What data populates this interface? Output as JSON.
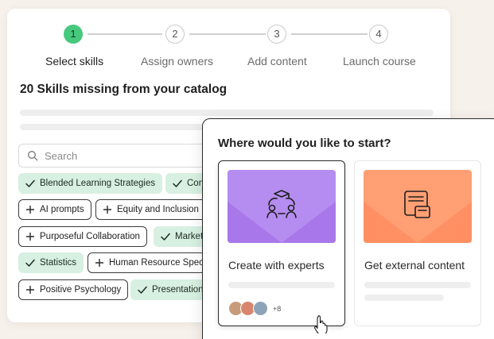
{
  "stepper": {
    "steps": [
      {
        "number": "1",
        "label": "Select skills",
        "state": "active"
      },
      {
        "number": "2",
        "label": "Assign owners",
        "state": "pending"
      },
      {
        "number": "3",
        "label": "Add content",
        "state": "pending"
      },
      {
        "number": "4",
        "label": "Launch course",
        "state": "pending"
      }
    ]
  },
  "catalog": {
    "heading": "20 Skills missing from your catalog",
    "search": {
      "placeholder": "Search",
      "icon": "search-icon"
    },
    "chips": [
      {
        "label": "Blended Learning Strategies",
        "state": "selected",
        "icon": "check-icon"
      },
      {
        "label": "Con",
        "state": "selected",
        "icon": "check-icon"
      },
      {
        "label": "AI prompts",
        "state": "unselected",
        "icon": "plus-icon"
      },
      {
        "label": "Equity and Inclusion",
        "state": "unselected",
        "icon": "plus-icon"
      },
      {
        "label": "Purposeful Collaboration",
        "state": "unselected",
        "icon": "plus-icon"
      },
      {
        "label": "Market",
        "state": "selected",
        "icon": "check-icon"
      },
      {
        "label": "Statistics",
        "state": "selected",
        "icon": "check-icon"
      },
      {
        "label": "Human Resource Speci",
        "state": "unselected",
        "icon": "plus-icon"
      },
      {
        "label": "Positive Psychology",
        "state": "unselected",
        "icon": "plus-icon"
      },
      {
        "label": "Presentation",
        "state": "selected",
        "icon": "check-icon"
      }
    ]
  },
  "modal": {
    "title": "Where would you like to start?",
    "options": [
      {
        "label": "Create with experts",
        "icon": "experts-icon",
        "selected": true,
        "extra_count": "+8"
      },
      {
        "label": "Get external content",
        "icon": "external-content-icon",
        "selected": false
      }
    ]
  },
  "colors": {
    "accent_green": "#47c97d",
    "chip_selected_bg": "#d7f0e1",
    "purple_thumb": "#b58cf0",
    "orange_thumb": "#ff9f73",
    "page_bg": "#f7f1ec"
  }
}
